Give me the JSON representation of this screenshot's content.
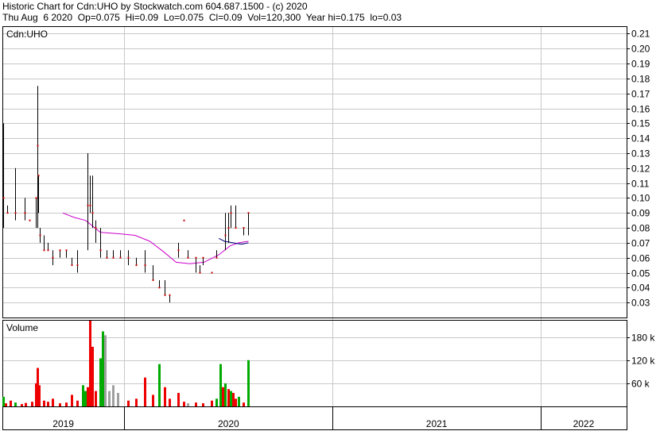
{
  "header": {
    "line1": "Historic Chart for Cdn:UHO by Stockwatch.com 604.687.1500 - (c) 2020",
    "line2": "Thu Aug  6 2020  Op=0.075  Hi=0.09  Lo=0.075  Cl=0.09  Vol=120,300  Year hi=0.175  lo=0.03"
  },
  "colors": {
    "grid": "#c8c8c8",
    "frame": "#000000",
    "bar": "#000000",
    "close_marker": "#cc0000",
    "moving_average": "#cc00cc",
    "short_average": "#000080",
    "volume_up": "#00aa00",
    "volume_down": "#ee0000",
    "volume_neutral": "#a0a0a0"
  },
  "chart_data": [
    {
      "type": "ohlc",
      "title": "Cdn:UHO",
      "ylim": [
        0.02,
        0.215
      ],
      "yticks": [
        0.03,
        0.04,
        0.05,
        0.06,
        0.07,
        0.08,
        0.09,
        0.1,
        0.11,
        0.12,
        0.13,
        0.14,
        0.15,
        0.16,
        0.17,
        0.18,
        0.19,
        0.2,
        0.21
      ],
      "ytick_labels": [
        "0.03",
        "0.04",
        "0.05",
        "0.06",
        "0.07",
        "0.08",
        "0.09",
        "0.10",
        "0.11",
        "0.12",
        "0.13",
        "0.14",
        "0.15",
        "0.16",
        "0.17",
        "0.18",
        "0.19",
        "0.20",
        "0.21"
      ],
      "x_range": [
        "2019-06-01",
        "2022-06-01"
      ],
      "x_period_starts": [
        "2019-01-01",
        "2020-01-01",
        "2021-01-01",
        "2022-01-01"
      ],
      "x_period_labels": [
        "2019",
        "2020",
        "2021",
        "2022"
      ],
      "bars": [
        {
          "date": "2019-06-03",
          "high": 0.15,
          "low": 0.08,
          "close": 0.1
        },
        {
          "date": "2019-06-10",
          "high": 0.095,
          "low": 0.09,
          "close": 0.09
        },
        {
          "date": "2019-06-24",
          "high": 0.12,
          "low": 0.085,
          "close": 0.09
        },
        {
          "date": "2019-07-10",
          "high": 0.1,
          "low": 0.085,
          "close": 0.09
        },
        {
          "date": "2019-07-18",
          "high": 0.085,
          "low": 0.085,
          "close": 0.085
        },
        {
          "date": "2019-07-30",
          "high": 0.1,
          "low": 0.08,
          "close": 0.1
        },
        {
          "date": "2019-08-01",
          "high": 0.175,
          "low": 0.08,
          "close": 0.135
        },
        {
          "date": "2019-08-03",
          "high": 0.115,
          "low": 0.09,
          "close": 0.115
        },
        {
          "date": "2019-08-06",
          "high": 0.08,
          "low": 0.07,
          "close": 0.075
        },
        {
          "date": "2019-08-12",
          "high": 0.075,
          "low": 0.065,
          "close": 0.065
        },
        {
          "date": "2019-08-20",
          "high": 0.07,
          "low": 0.065,
          "close": 0.065
        },
        {
          "date": "2019-08-28",
          "high": 0.065,
          "low": 0.055,
          "close": 0.06
        },
        {
          "date": "2019-09-10",
          "high": 0.065,
          "low": 0.06,
          "close": 0.065
        },
        {
          "date": "2019-09-20",
          "high": 0.065,
          "low": 0.06,
          "close": 0.065
        },
        {
          "date": "2019-10-01",
          "high": 0.06,
          "low": 0.055,
          "close": 0.055
        },
        {
          "date": "2019-10-10",
          "high": 0.065,
          "low": 0.05,
          "close": 0.055
        },
        {
          "date": "2019-10-28",
          "high": 0.13,
          "low": 0.065,
          "close": 0.095
        },
        {
          "date": "2019-11-02",
          "high": 0.115,
          "low": 0.09,
          "close": 0.095
        },
        {
          "date": "2019-11-06",
          "high": 0.115,
          "low": 0.08,
          "close": 0.09
        },
        {
          "date": "2019-11-12",
          "high": 0.085,
          "low": 0.07,
          "close": 0.08
        },
        {
          "date": "2019-11-20",
          "high": 0.08,
          "low": 0.06,
          "close": 0.065
        },
        {
          "date": "2019-12-01",
          "high": 0.065,
          "low": 0.06,
          "close": 0.06
        },
        {
          "date": "2019-12-12",
          "high": 0.065,
          "low": 0.06,
          "close": 0.06
        },
        {
          "date": "2019-12-24",
          "high": 0.065,
          "low": 0.06,
          "close": 0.06
        },
        {
          "date": "2020-01-08",
          "high": 0.065,
          "low": 0.055,
          "close": 0.06
        },
        {
          "date": "2020-01-22",
          "high": 0.06,
          "low": 0.055,
          "close": 0.055
        },
        {
          "date": "2020-02-06",
          "high": 0.065,
          "low": 0.05,
          "close": 0.055
        },
        {
          "date": "2020-02-20",
          "high": 0.055,
          "low": 0.045,
          "close": 0.045
        },
        {
          "date": "2020-03-02",
          "high": 0.045,
          "low": 0.04,
          "close": 0.04
        },
        {
          "date": "2020-03-12",
          "high": 0.045,
          "low": 0.035,
          "close": 0.035
        },
        {
          "date": "2020-03-20",
          "high": 0.035,
          "low": 0.03,
          "close": 0.035
        },
        {
          "date": "2020-04-05",
          "high": 0.07,
          "low": 0.06,
          "close": 0.065
        },
        {
          "date": "2020-04-15",
          "high": 0.085,
          "low": 0.085,
          "close": 0.085
        },
        {
          "date": "2020-04-22",
          "high": 0.065,
          "low": 0.06,
          "close": 0.06
        },
        {
          "date": "2020-05-05",
          "high": 0.06,
          "low": 0.05,
          "close": 0.06
        },
        {
          "date": "2020-05-12",
          "high": 0.055,
          "low": 0.05,
          "close": 0.05
        },
        {
          "date": "2020-05-18",
          "high": 0.06,
          "low": 0.055,
          "close": 0.06
        },
        {
          "date": "2020-06-02",
          "high": 0.05,
          "low": 0.05,
          "close": 0.05
        },
        {
          "date": "2020-06-10",
          "high": 0.065,
          "low": 0.06,
          "close": 0.06
        },
        {
          "date": "2020-06-26",
          "high": 0.09,
          "low": 0.065,
          "close": 0.075
        },
        {
          "date": "2020-07-01",
          "high": 0.09,
          "low": 0.07,
          "close": 0.08
        },
        {
          "date": "2020-07-06",
          "high": 0.095,
          "low": 0.08,
          "close": 0.09
        },
        {
          "date": "2020-07-14",
          "high": 0.095,
          "low": 0.08,
          "close": 0.08
        },
        {
          "date": "2020-07-28",
          "high": 0.08,
          "low": 0.075,
          "close": 0.08
        },
        {
          "date": "2020-08-06",
          "high": 0.09,
          "low": 0.075,
          "close": 0.09
        }
      ],
      "moving_average": [
        {
          "date": "2019-09-15",
          "value": 0.09
        },
        {
          "date": "2019-10-05",
          "value": 0.087
        },
        {
          "date": "2019-10-25",
          "value": 0.085
        },
        {
          "date": "2019-11-20",
          "value": 0.077
        },
        {
          "date": "2019-12-25",
          "value": 0.076
        },
        {
          "date": "2020-01-20",
          "value": 0.075
        },
        {
          "date": "2020-02-15",
          "value": 0.071
        },
        {
          "date": "2020-03-10",
          "value": 0.064
        },
        {
          "date": "2020-04-01",
          "value": 0.057
        },
        {
          "date": "2020-04-25",
          "value": 0.056
        },
        {
          "date": "2020-05-20",
          "value": 0.057
        },
        {
          "date": "2020-06-15",
          "value": 0.062
        },
        {
          "date": "2020-07-05",
          "value": 0.068
        },
        {
          "date": "2020-07-20",
          "value": 0.07
        },
        {
          "date": "2020-08-06",
          "value": 0.071
        }
      ],
      "short_average": [
        {
          "date": "2020-06-15",
          "value": 0.073
        },
        {
          "date": "2020-06-25",
          "value": 0.071
        },
        {
          "date": "2020-07-10",
          "value": 0.07
        },
        {
          "date": "2020-07-25",
          "value": 0.069
        },
        {
          "date": "2020-08-06",
          "value": 0.07
        }
      ]
    },
    {
      "type": "bar",
      "title": "Volume",
      "ylim": [
        0,
        225000
      ],
      "yticks": [
        60000,
        120000,
        180000
      ],
      "ytick_labels": [
        "60 k",
        "120 k",
        "180 k"
      ],
      "bars": [
        {
          "date": "2019-06-03",
          "volume": 25000,
          "dir": "up"
        },
        {
          "date": "2019-06-07",
          "volume": 8000,
          "dir": "down"
        },
        {
          "date": "2019-06-15",
          "volume": 15000,
          "dir": "down"
        },
        {
          "date": "2019-06-24",
          "volume": 10000,
          "dir": "up"
        },
        {
          "date": "2019-07-05",
          "volume": 6000,
          "dir": "down"
        },
        {
          "date": "2019-07-12",
          "volume": 9000,
          "dir": "down"
        },
        {
          "date": "2019-07-22",
          "volume": 12000,
          "dir": "down"
        },
        {
          "date": "2019-07-30",
          "volume": 60000,
          "dir": "down"
        },
        {
          "date": "2019-08-01",
          "volume": 100000,
          "dir": "down"
        },
        {
          "date": "2019-08-04",
          "volume": 55000,
          "dir": "down"
        },
        {
          "date": "2019-08-12",
          "volume": 15000,
          "dir": "down"
        },
        {
          "date": "2019-08-20",
          "volume": 12000,
          "dir": "down"
        },
        {
          "date": "2019-08-28",
          "volume": 20000,
          "dir": "down"
        },
        {
          "date": "2019-09-10",
          "volume": 8000,
          "dir": "down"
        },
        {
          "date": "2019-09-20",
          "volume": 10000,
          "dir": "down"
        },
        {
          "date": "2019-10-01",
          "volume": 30000,
          "dir": "down"
        },
        {
          "date": "2019-10-10",
          "volume": 15000,
          "dir": "down"
        },
        {
          "date": "2019-10-20",
          "volume": 55000,
          "dir": "up"
        },
        {
          "date": "2019-10-24",
          "volume": 40000,
          "dir": "up"
        },
        {
          "date": "2019-10-28",
          "volume": 50000,
          "dir": "down"
        },
        {
          "date": "2019-11-02",
          "volume": 245000,
          "dir": "down"
        },
        {
          "date": "2019-11-06",
          "volume": 155000,
          "dir": "down"
        },
        {
          "date": "2019-11-12",
          "volume": 40000,
          "dir": "down"
        },
        {
          "date": "2019-11-20",
          "volume": 125000,
          "dir": "up"
        },
        {
          "date": "2019-11-24",
          "volume": 195000,
          "dir": "up"
        },
        {
          "date": "2019-11-28",
          "volume": 185000,
          "dir": "neutral"
        },
        {
          "date": "2019-12-05",
          "volume": 40000,
          "dir": "neutral"
        },
        {
          "date": "2019-12-12",
          "volume": 55000,
          "dir": "neutral"
        },
        {
          "date": "2019-12-20",
          "volume": 35000,
          "dir": "neutral"
        },
        {
          "date": "2020-01-08",
          "volume": 15000,
          "dir": "down"
        },
        {
          "date": "2020-01-22",
          "volume": 20000,
          "dir": "down"
        },
        {
          "date": "2020-02-06",
          "volume": 75000,
          "dir": "down"
        },
        {
          "date": "2020-02-20",
          "volume": 30000,
          "dir": "down"
        },
        {
          "date": "2020-03-02",
          "volume": 110000,
          "dir": "up"
        },
        {
          "date": "2020-03-12",
          "volume": 50000,
          "dir": "down"
        },
        {
          "date": "2020-03-20",
          "volume": 20000,
          "dir": "down"
        },
        {
          "date": "2020-04-05",
          "volume": 35000,
          "dir": "down"
        },
        {
          "date": "2020-04-15",
          "volume": 12000,
          "dir": "down"
        },
        {
          "date": "2020-04-22",
          "volume": 8000,
          "dir": "neutral"
        },
        {
          "date": "2020-05-05",
          "volume": 10000,
          "dir": "down"
        },
        {
          "date": "2020-05-18",
          "volume": 8000,
          "dir": "down"
        },
        {
          "date": "2020-06-02",
          "volume": 15000,
          "dir": "down"
        },
        {
          "date": "2020-06-10",
          "volume": 20000,
          "dir": "up"
        },
        {
          "date": "2020-06-18",
          "volume": 110000,
          "dir": "up"
        },
        {
          "date": "2020-06-22",
          "volume": 50000,
          "dir": "down"
        },
        {
          "date": "2020-06-26",
          "volume": 60000,
          "dir": "up"
        },
        {
          "date": "2020-07-01",
          "volume": 45000,
          "dir": "down"
        },
        {
          "date": "2020-07-06",
          "volume": 40000,
          "dir": "up"
        },
        {
          "date": "2020-07-10",
          "volume": 35000,
          "dir": "down"
        },
        {
          "date": "2020-07-14",
          "volume": 20000,
          "dir": "down"
        },
        {
          "date": "2020-07-20",
          "volume": 25000,
          "dir": "up"
        },
        {
          "date": "2020-07-28",
          "volume": 10000,
          "dir": "down"
        },
        {
          "date": "2020-08-06",
          "volume": 120300,
          "dir": "up"
        }
      ]
    }
  ]
}
